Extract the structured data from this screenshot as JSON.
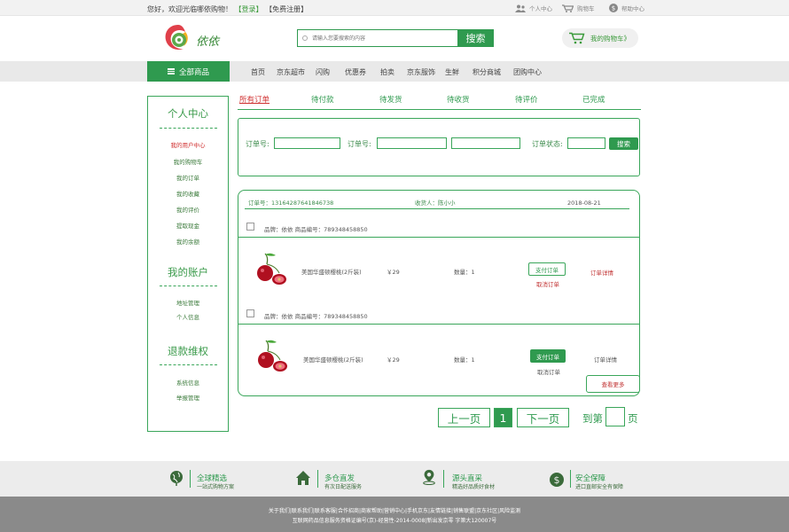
{
  "topbar": {
    "welcome": "您好，欢迎光临哪依购物！",
    "login": "【登录】",
    "register": "【免费注册】",
    "links": [
      {
        "label": "个人中心",
        "icon": "people-icon"
      },
      {
        "label": "购物车",
        "icon": "cart-icon"
      },
      {
        "label": "帮助中心",
        "icon": "dollar-icon"
      }
    ]
  },
  "header": {
    "logo_text": "依依",
    "search_placeholder": "请输入您要搜索的内容",
    "search_button": "搜索",
    "cart_label": "我的购物车》"
  },
  "nav": {
    "all_categories": "全部商品",
    "items": [
      "首页",
      "京东超市",
      "闪购",
      "优惠券",
      "拍卖",
      "京东服饰",
      "生鲜",
      "积分商城",
      "团购中心"
    ]
  },
  "sidebar": {
    "sections": [
      {
        "title": "个人中心",
        "links": [
          "我的用户中心",
          "我的购物车",
          "我的订单",
          "我的收藏",
          "我的评价",
          "提取现金",
          "我的余额"
        ]
      },
      {
        "title": "我的账户",
        "links": [
          "地址管理",
          "个人信息"
        ]
      },
      {
        "title": "退款维权",
        "links": [
          "系统信息",
          "举报管理"
        ]
      }
    ],
    "active_link": "我的用户中心"
  },
  "tabs": [
    "所有订单",
    "待付款",
    "待发货",
    "待收货",
    "待评价",
    "已完成"
  ],
  "filter": {
    "order_no_label_1": "订单号:",
    "order_no_label_2": "订单号:",
    "status_label": "订单状态:",
    "search_button": "搜索"
  },
  "order": {
    "order_no": "订单号：13164287641846738",
    "receiver": "收货人：陈小小",
    "date": "2018-08-21",
    "items": [
      {
        "brand_line": "品牌：依依   商品编号：789348458850",
        "name": "美国华盛顿樱桃(2斤装)",
        "price": "￥29",
        "qty": "数量：1",
        "pay_button": "支付订单",
        "cancel_link": "取消订单",
        "detail_link": "订单详情"
      },
      {
        "brand_line": "品牌：依依   商品编号：789348458850",
        "name": "美国华盛顿樱桃(2斤装)",
        "price": "￥29",
        "qty": "数量：1",
        "pay_button": "支付订单",
        "cancel_link": "取消订单",
        "detail_link": "订单详情"
      }
    ],
    "more_button": "查看更多"
  },
  "pagination": {
    "prev": "上一页",
    "current": "1",
    "next": "下一页",
    "goto": "到第",
    "page_unit": "页"
  },
  "features": [
    {
      "title": "全球精选",
      "subtitle": "一站式购物方案",
      "icon": "globe-pin-icon"
    },
    {
      "title": "多仓直发",
      "subtitle": "有次日配送服务",
      "icon": "home-icon"
    },
    {
      "title": "源头直采",
      "subtitle": "精选好品质好食材",
      "icon": "location-pin-icon"
    },
    {
      "title": "安全保障",
      "subtitle": "进口直邮安全有保障",
      "icon": "dollar-icon"
    }
  ],
  "footer": {
    "links_line": "关于我们|联系我们|联系客服|合作招商|商家帮助|营销中心|手机京东|友情链接|销售联盟|京东社区|风险监测",
    "license_line": "互联网药品信息服务资格证编号(京)-经营性-2014-0008|新出发京零 字第大120007号"
  },
  "colors": {
    "brand_green": "#2f9a4f",
    "alert_red": "#d03030",
    "footer_gray": "#8a8a8a"
  }
}
